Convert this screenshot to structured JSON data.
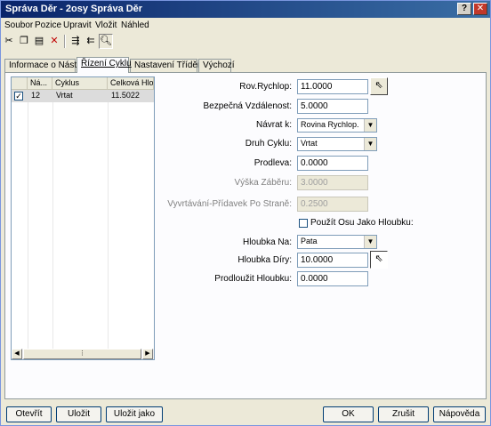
{
  "window": {
    "title": "Správa Děr - 2osy Správa Děr"
  },
  "menu": [
    "Soubor",
    "Pozice",
    "Upravit",
    "Vložit",
    "Náhled"
  ],
  "toolbar": {
    "icons": [
      "scissors-icon",
      "copy-icon",
      "paste-icon",
      "delete-icon",
      "indent-right-icon",
      "indent-left-icon",
      "preview-icon"
    ]
  },
  "tabs": [
    "Informace o Nástroji",
    "Řízení Cyklu",
    "Nastavení Třídění",
    "Výchozí"
  ],
  "active_tab": "Řízení Cyklu",
  "list": {
    "headers": [
      "Ná...",
      "Cyklus",
      "Celková Hlou"
    ],
    "rows": [
      {
        "checked": true,
        "num": "12",
        "cycle": "Vrtat",
        "depth": "11.5022"
      }
    ]
  },
  "form": {
    "rov_rychlop": {
      "label": "Rov.Rychlop:",
      "value": "11.0000"
    },
    "bezpecna_vzdalenost": {
      "label": "Bezpečná Vzdálenost:",
      "value": "5.0000"
    },
    "navrat_k": {
      "label": "Návrat k:",
      "value": "Rovina Rychlop."
    },
    "druh_cyklu": {
      "label": "Druh Cyklu:",
      "value": "Vrtat"
    },
    "prodleva": {
      "label": "Prodleva:",
      "value": "0.0000"
    },
    "vyska_zaberu": {
      "label": "Výška Záběru:",
      "value": "3.0000"
    },
    "vyvrtavani_pridavek": {
      "label": "Vyvrtávání-Přídavek Po Straně:",
      "value": "0.2500"
    },
    "pouzit_osu": {
      "label": "Použít Osu Jako Hloubku:",
      "checked": false
    },
    "hloubka_na": {
      "label": "Hloubka Na:",
      "value": "Pata"
    },
    "hloubka_diry": {
      "label": "Hloubka Díry:",
      "value": "10.0000"
    },
    "prodlouzit_hloubku": {
      "label": "Prodloužit Hloubku:",
      "value": "0.0000"
    }
  },
  "buttons": {
    "open": "Otevřít",
    "save": "Uložit",
    "save_as": "Uložit jako",
    "ok": "OK",
    "cancel": "Zrušit",
    "help": "Nápověda"
  },
  "titlebar_buttons": {
    "help": "?",
    "close": "✕"
  }
}
